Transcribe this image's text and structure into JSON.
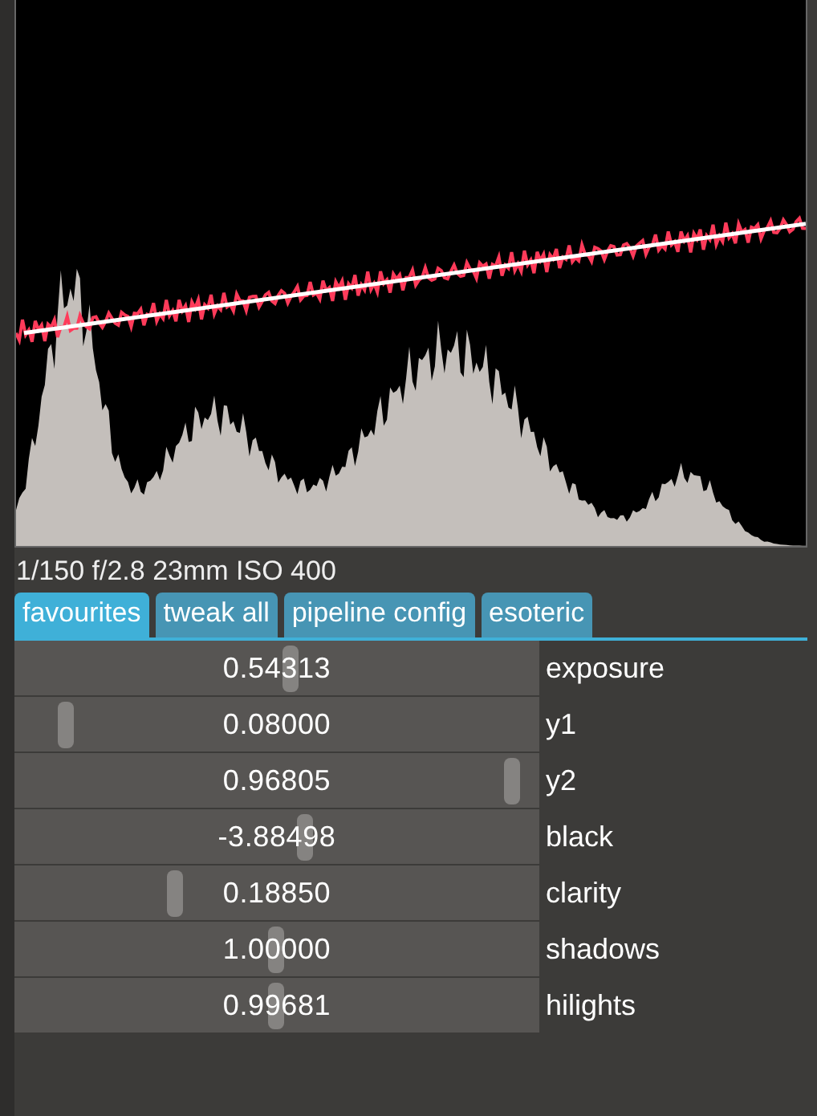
{
  "info": "1/150 f/2.8 23mm ISO 400",
  "tabs": [
    {
      "label": "favourites",
      "selected": true
    },
    {
      "label": "tweak all",
      "selected": false
    },
    {
      "label": "pipeline config",
      "selected": false
    },
    {
      "label": "esoteric",
      "selected": false
    }
  ],
  "params": [
    {
      "value": "0.54313",
      "label": "exposure",
      "level": 0.526
    },
    {
      "value": "0.08000",
      "label": "y1",
      "level": 0.098
    },
    {
      "value": "0.96805",
      "label": "y2",
      "level": 0.948
    },
    {
      "value": "-3.88498",
      "label": "black",
      "level": 0.553
    },
    {
      "value": "0.18850",
      "label": "clarity",
      "level": 0.306
    },
    {
      "value": "1.00000",
      "label": "shadows",
      "level": 0.498
    },
    {
      "value": "0.99681",
      "label": "hilights",
      "level": 0.498
    }
  ]
}
